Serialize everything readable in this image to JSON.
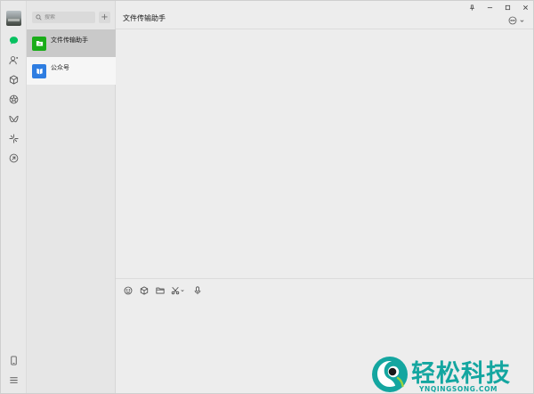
{
  "rail": {
    "icons": [
      "chat-icon",
      "contacts-icon",
      "favorites-icon",
      "moments-icon",
      "channels-icon",
      "mini-programs-icon",
      "search-web-icon",
      "phone-icon",
      "menu-icon"
    ],
    "accent": "#07c160"
  },
  "list": {
    "search_placeholder": "搜索",
    "add_label": "+",
    "items": [
      {
        "name": "文件传输助手",
        "avatar_color": "#1aad19",
        "icon": "folder-icon"
      },
      {
        "name": "公众号",
        "avatar_color": "#2e7de1",
        "icon": "bookmark-icon"
      }
    ]
  },
  "main": {
    "title": "文件传输助手",
    "toolbar": [
      "emoji-icon",
      "favorites-icon",
      "folder-icon",
      "scissors-icon",
      "microphone-icon"
    ],
    "message_input": ""
  },
  "watermark": {
    "text": "轻松科技",
    "url": "YNQINGSONG.COM",
    "color": "#14a6a0"
  }
}
